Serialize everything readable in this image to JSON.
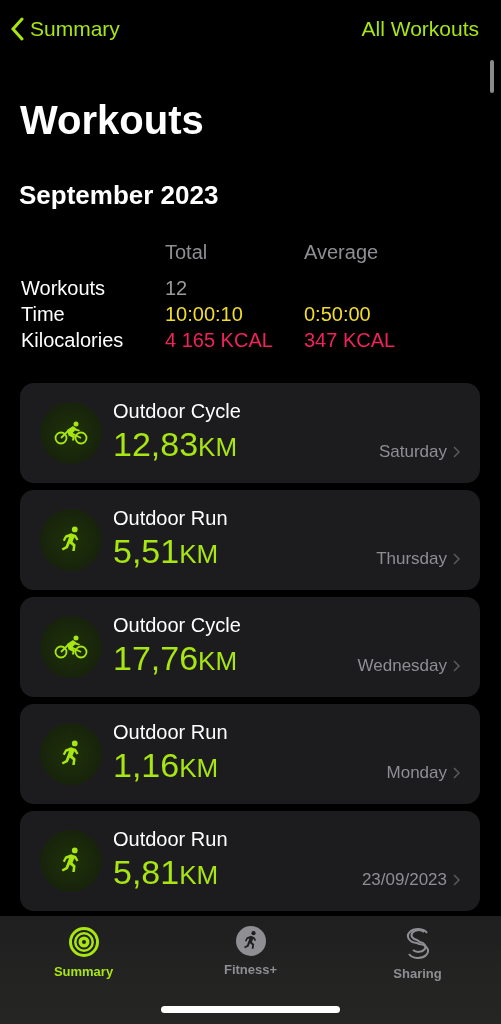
{
  "nav": {
    "back": "Summary",
    "action": "All Workouts"
  },
  "title": "Workouts",
  "month": "September 2023",
  "stats": {
    "columns": [
      "Total",
      "Average"
    ],
    "rows": [
      {
        "kind": "count",
        "label": "Workouts",
        "total": "12"
      },
      {
        "kind": "time",
        "label": "Time",
        "total": "10:00:10",
        "average": "0:50:00"
      },
      {
        "kind": "energy",
        "label": "Kilocalories",
        "total": "4 165 KCAL",
        "average": "347 KCAL"
      }
    ]
  },
  "workouts": [
    {
      "kind": "cycle",
      "name": "Outdoor Cycle",
      "distance": "12,83",
      "unit": "KM",
      "date": "Saturday"
    },
    {
      "kind": "run",
      "name": "Outdoor Run",
      "distance": "5,51",
      "unit": "KM",
      "date": "Thursday"
    },
    {
      "kind": "cycle",
      "name": "Outdoor Cycle",
      "distance": "17,76",
      "unit": "KM",
      "date": "Wednesday"
    },
    {
      "kind": "run",
      "name": "Outdoor Run",
      "distance": "1,16",
      "unit": "KM",
      "date": "Monday"
    },
    {
      "kind": "run",
      "name": "Outdoor Run",
      "distance": "5,81",
      "unit": "KM",
      "date": "23/09/2023"
    }
  ],
  "tabs": [
    {
      "kind": "rings",
      "label": "Summary",
      "selected": true
    },
    {
      "kind": "fitness",
      "label": "Fitness+",
      "selected": false
    },
    {
      "kind": "sharing",
      "label": "Sharing",
      "selected": false
    }
  ]
}
